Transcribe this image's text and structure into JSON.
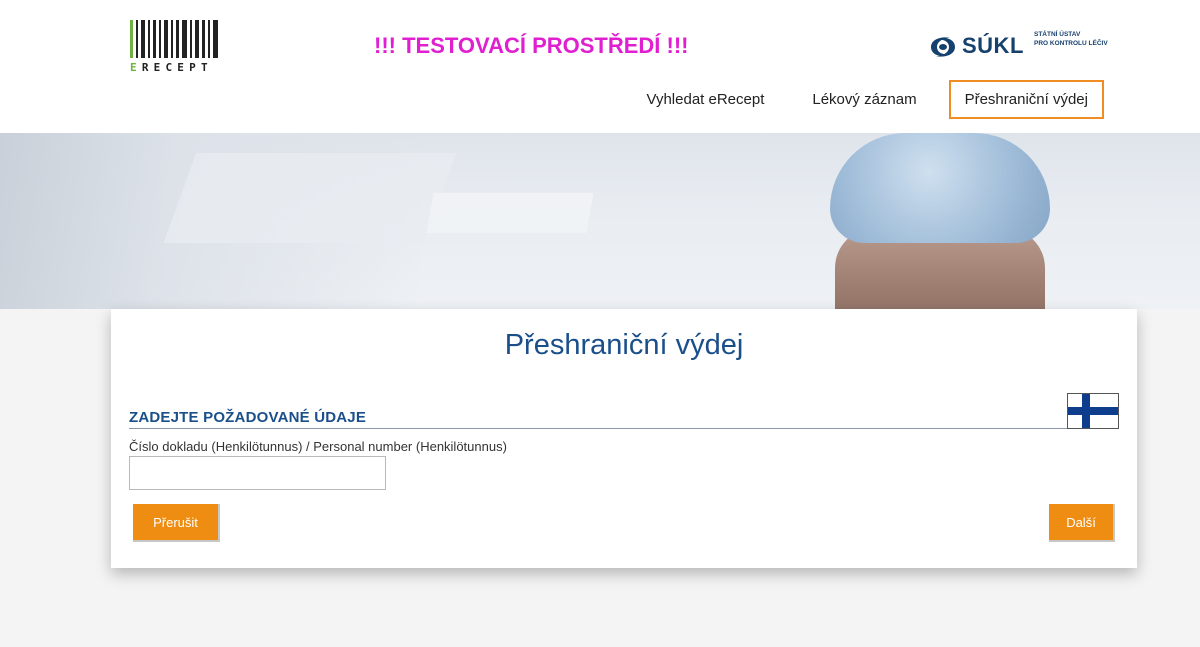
{
  "header": {
    "logo_text_first": "E",
    "logo_text_rest": "RECEPT",
    "test_banner": "!!! TESTOVACÍ PROSTŘEDÍ !!!",
    "sukl": {
      "name": "SÚKL",
      "subtitle_line1": "Státní ústav",
      "subtitle_line2": "pro kontrolu léčiv"
    },
    "nav": [
      {
        "label": "Vyhledat eRecept",
        "active": false
      },
      {
        "label": "Lékový záznam",
        "active": false
      },
      {
        "label": "Přeshraniční výdej",
        "active": true
      }
    ]
  },
  "card": {
    "title": "Přeshraniční výdej",
    "section_heading": "ZADEJTE POŽADOVANÉ ÚDAJE",
    "flag_icon": "finland-flag-icon",
    "field_label": "Číslo dokladu (Henkilötunnus) / Personal number (Henkilötunnus)",
    "field_value": "",
    "cancel_label": "Přerušit",
    "next_label": "Další"
  },
  "colors": {
    "accent_orange": "#ef8d12",
    "title_blue": "#1a4f8a",
    "test_banner_magenta": "#e020d0",
    "logo_green": "#6cb33f"
  }
}
